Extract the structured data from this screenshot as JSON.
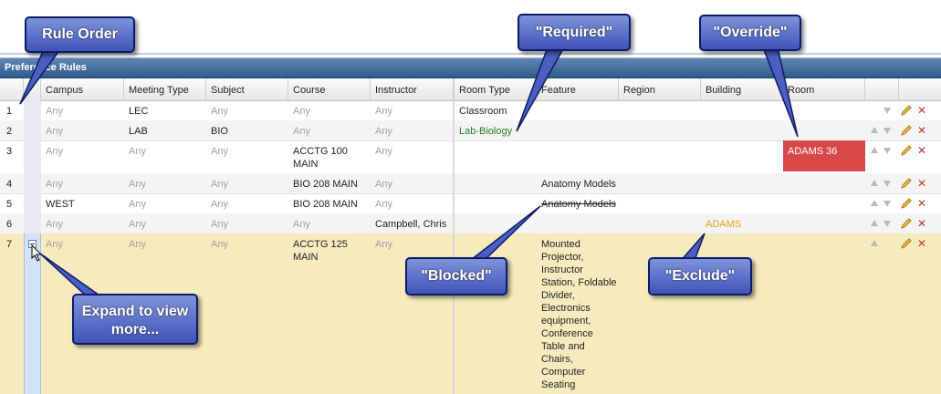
{
  "panel": {
    "title": "Preference Rules"
  },
  "columns": [
    "Campus",
    "Meeting Type",
    "Subject",
    "Course",
    "Instructor",
    "Room Type",
    "Feature",
    "Region",
    "Building",
    "Room"
  ],
  "rows": [
    {
      "num": "1",
      "campus": "Any",
      "meeting": "LEC",
      "subject": "Any",
      "course": "Any",
      "instructor": "Any",
      "roomtype": "Classroom",
      "feature": "",
      "region": "",
      "building": "",
      "room": ""
    },
    {
      "num": "2",
      "campus": "Any",
      "meeting": "LAB",
      "subject": "BIO",
      "course": "Any",
      "instructor": "Any",
      "roomtype": "Lab-Biology",
      "feature": "",
      "region": "",
      "building": "",
      "room": ""
    },
    {
      "num": "3",
      "campus": "Any",
      "meeting": "Any",
      "subject": "Any",
      "course": "ACCTG 100 MAIN",
      "instructor": "Any",
      "roomtype": "",
      "feature": "",
      "region": "",
      "building": "",
      "room": "ADAMS 36"
    },
    {
      "num": "4",
      "campus": "Any",
      "meeting": "Any",
      "subject": "Any",
      "course": "BIO 208 MAIN",
      "instructor": "Any",
      "roomtype": "",
      "feature": "Anatomy Models",
      "region": "",
      "building": "",
      "room": ""
    },
    {
      "num": "5",
      "campus": "WEST",
      "meeting": "Any",
      "subject": "Any",
      "course": "BIO 208 MAIN",
      "instructor": "Any",
      "roomtype": "",
      "feature": "Anatomy Models",
      "region": "",
      "building": "",
      "room": ""
    },
    {
      "num": "6",
      "campus": "Any",
      "meeting": "Any",
      "subject": "Any",
      "course": "Any",
      "instructor": "Campbell, Chris",
      "roomtype": "",
      "feature": "",
      "region": "",
      "building": "ADAMS",
      "room": ""
    },
    {
      "num": "7",
      "campus": "Any",
      "meeting": "Any",
      "subject": "Any",
      "course": "ACCTG 125 MAIN",
      "instructor": "Any",
      "roomtype": "",
      "feature": "Mounted Projector, Instructor Station, Foldable Divider, Electronics equipment, Conference Table and Chairs, Computer Seating",
      "region": "",
      "building": "",
      "room": ""
    }
  ],
  "callouts": {
    "rule_order": "Rule Order",
    "required": "\"Required\"",
    "override": "\"Override\"",
    "blocked": "\"Blocked\"",
    "exclude": "\"Exclude\"",
    "expand": "Expand to view more..."
  },
  "colors": {
    "override_bg": "#d94848",
    "required_text": "#1d7f1d",
    "exclude_text": "#e7a016",
    "selected_row": "#f7ebbe"
  },
  "icons": [
    "move-up-icon",
    "move-down-icon",
    "edit-pencil-icon",
    "delete-icon",
    "collapse-icon"
  ]
}
